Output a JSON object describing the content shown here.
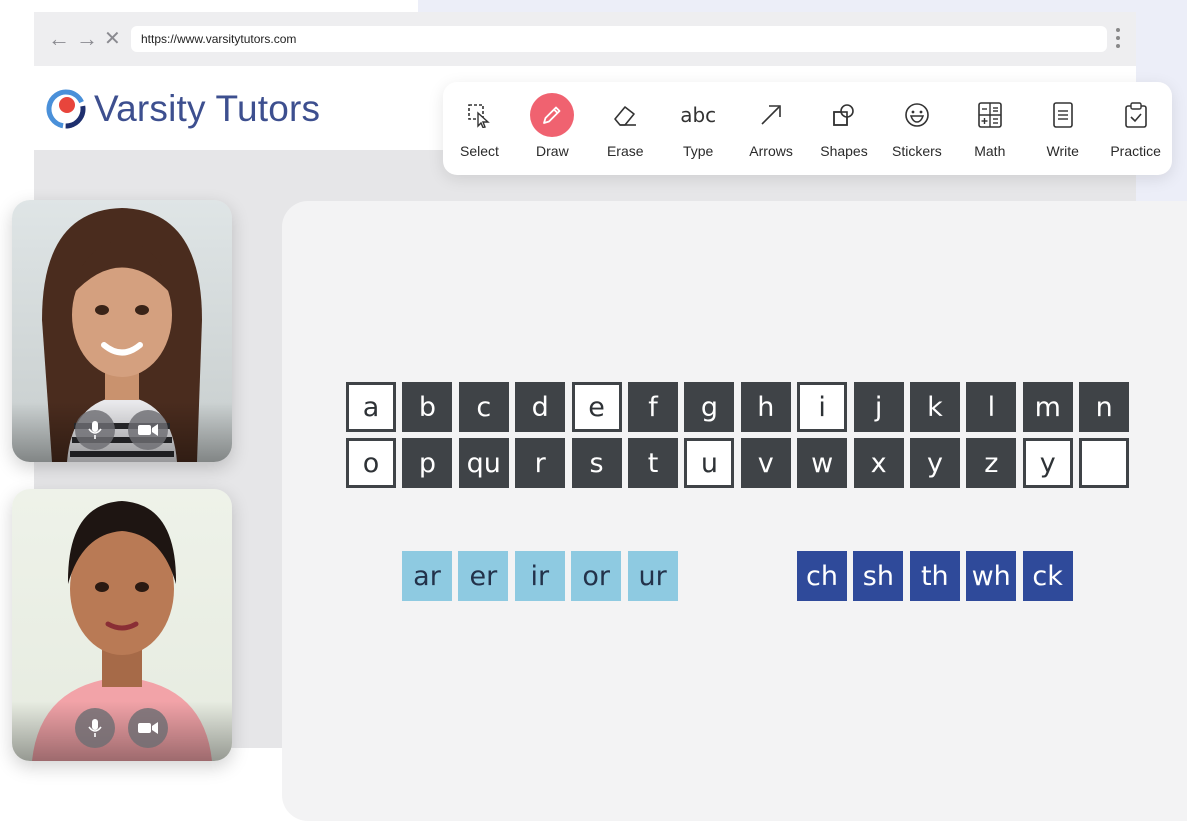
{
  "browser": {
    "back_icon": "←",
    "forward_icon": "→",
    "stop_icon": "✕",
    "url": "https://www.varsitytutors.com"
  },
  "logo": {
    "text": "Varsity Tutors"
  },
  "toolbar": {
    "active_color": "#f06270",
    "tools": [
      {
        "label": "Select",
        "icon": "select-icon"
      },
      {
        "label": "Draw",
        "icon": "pencil-icon",
        "active": true
      },
      {
        "label": "Erase",
        "icon": "eraser-icon"
      },
      {
        "label": "Type",
        "icon": "abc-icon",
        "glyph": "abc"
      },
      {
        "label": "Arrows",
        "icon": "arrow-icon"
      },
      {
        "label": "Shapes",
        "icon": "shapes-icon"
      },
      {
        "label": "Stickers",
        "icon": "smiley-icon"
      },
      {
        "label": "Math",
        "icon": "calculator-icon"
      },
      {
        "label": "Write",
        "icon": "document-icon"
      },
      {
        "label": "Practice",
        "icon": "clipboard-icon"
      }
    ]
  },
  "videos": [
    {
      "participant": "student",
      "controls": [
        "mic-icon",
        "camera-icon"
      ]
    },
    {
      "participant": "tutor",
      "controls": [
        "mic-icon",
        "camera-icon"
      ]
    }
  ],
  "board": {
    "row1": [
      {
        "t": "a",
        "s": "light"
      },
      {
        "t": "b",
        "s": "dark"
      },
      {
        "t": "c",
        "s": "dark"
      },
      {
        "t": "d",
        "s": "dark"
      },
      {
        "t": "e",
        "s": "light"
      },
      {
        "t": "f",
        "s": "dark"
      },
      {
        "t": "g",
        "s": "dark"
      },
      {
        "t": "h",
        "s": "dark"
      },
      {
        "t": "i",
        "s": "light"
      },
      {
        "t": "j",
        "s": "dark"
      },
      {
        "t": "k",
        "s": "dark"
      },
      {
        "t": "l",
        "s": "dark"
      },
      {
        "t": "m",
        "s": "dark"
      },
      {
        "t": "n",
        "s": "dark"
      }
    ],
    "row2": [
      {
        "t": "o",
        "s": "light"
      },
      {
        "t": "p",
        "s": "dark"
      },
      {
        "t": "qu",
        "s": "dark"
      },
      {
        "t": "r",
        "s": "dark"
      },
      {
        "t": "s",
        "s": "dark"
      },
      {
        "t": "t",
        "s": "dark"
      },
      {
        "t": "u",
        "s": "light"
      },
      {
        "t": "v",
        "s": "dark"
      },
      {
        "t": "w",
        "s": "dark"
      },
      {
        "t": "x",
        "s": "dark"
      },
      {
        "t": "y",
        "s": "dark"
      },
      {
        "t": "z",
        "s": "dark"
      },
      {
        "t": "y",
        "s": "light"
      },
      {
        "t": "",
        "s": "light"
      }
    ],
    "vowel_teams": [
      {
        "t": "ar",
        "s": "lblue"
      },
      {
        "t": "er",
        "s": "lblue"
      },
      {
        "t": "ir",
        "s": "lblue"
      },
      {
        "t": "or",
        "s": "lblue"
      },
      {
        "t": "ur",
        "s": "lblue"
      }
    ],
    "digraphs": [
      {
        "t": "ch",
        "s": "dblue"
      },
      {
        "t": "sh",
        "s": "dblue"
      },
      {
        "t": "th",
        "s": "dblue"
      },
      {
        "t": "wh",
        "s": "dblue"
      },
      {
        "t": "ck",
        "s": "dblue"
      }
    ],
    "colors": {
      "dark_tile": "#3f4347",
      "light_blue_tile": "#8ecae1",
      "dark_blue_tile": "#2f4a9a"
    }
  }
}
